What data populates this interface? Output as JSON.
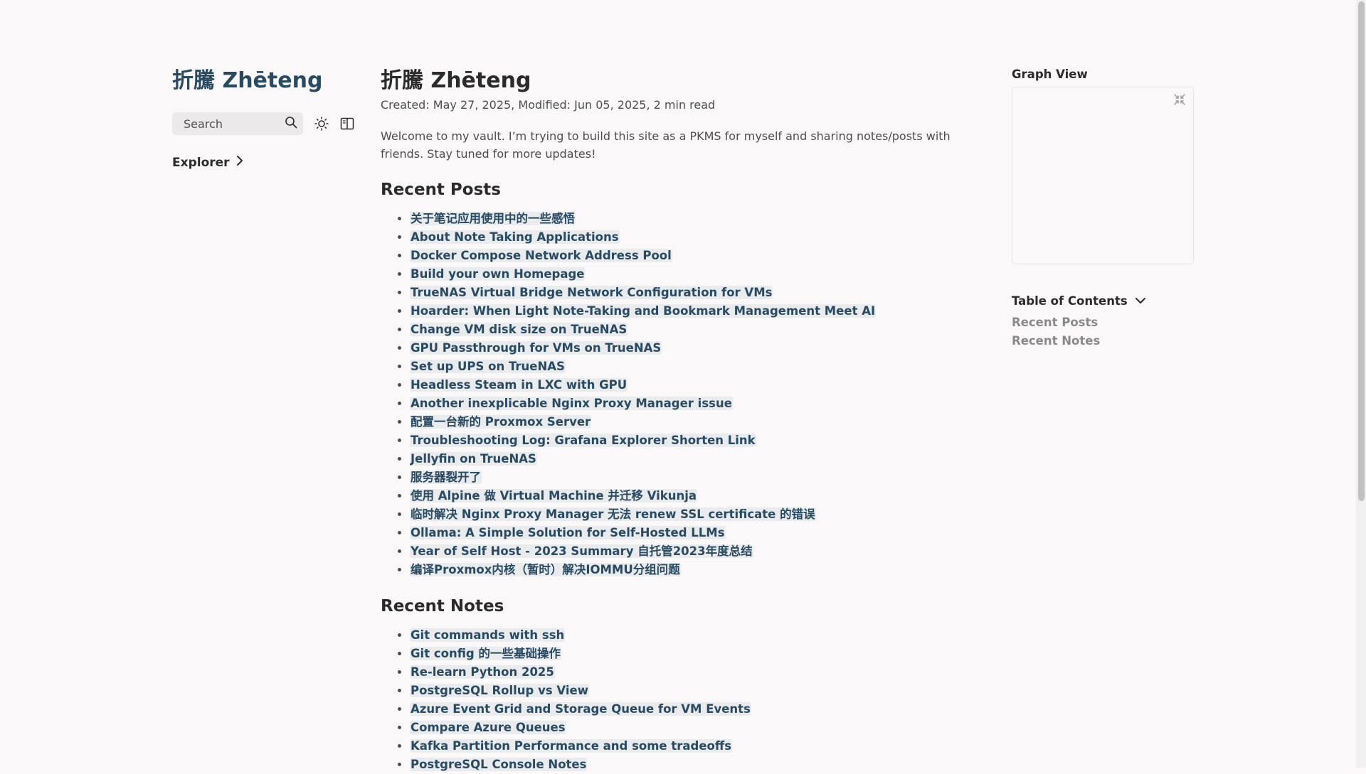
{
  "site": {
    "title": "折騰 Zhēteng"
  },
  "search": {
    "placeholder": "Search"
  },
  "icons": {
    "search": "search-icon",
    "darkmode": "sun-icon",
    "reader": "book-icon",
    "explorer_toggle": "chevron-right-icon",
    "graph_expand": "expand-icon",
    "toc_toggle": "chevron-down-icon"
  },
  "explorer": {
    "label": "Explorer"
  },
  "page": {
    "title": "折騰 Zhēteng",
    "created": "Created: May 27, 2025,",
    "modified": "Modified: Jun 05, 2025,",
    "read_time": "2 min read",
    "intro": "Welcome to my vault. I’m trying to build this site as a PKMS for myself and sharing notes/posts with friends. Stay tuned for more updates!"
  },
  "recent_posts": {
    "heading": "Recent Posts",
    "items": [
      "关于笔记应用使用中的一些感悟",
      "About Note Taking Applications",
      "Docker Compose Network Address Pool",
      "Build your own Homepage",
      "TrueNAS Virtual Bridge Network Configuration for VMs",
      "Hoarder: When Light Note-Taking and Bookmark Management Meet AI",
      "Change VM disk size on TrueNAS",
      "GPU Passthrough for VMs on TrueNAS",
      "Set up UPS on TrueNAS",
      "Headless Steam in LXC with GPU",
      "Another inexplicable Nginx Proxy Manager issue",
      "配置一台新的 Proxmox Server",
      "Troubleshooting Log: Grafana Explorer Shorten Link",
      "Jellyfin on TrueNAS",
      "服务器裂开了",
      "使用 Alpine 做 Virtual Machine 并迁移 Vikunja",
      "临时解决 Nginx Proxy Manager 无法 renew SSL certificate 的错误",
      "Ollama: A Simple Solution for Self-Hosted LLMs",
      "Year of Self Host - 2023 Summary 自托管2023年度总结",
      "编译Proxmox内核（暂时）解决IOMMU分组问题"
    ]
  },
  "recent_notes": {
    "heading": "Recent Notes",
    "items": [
      "Git commands with ssh",
      "Git config 的一些基础操作",
      "Re-learn Python 2025",
      "PostgreSQL Rollup vs View",
      "Azure Event Grid and Storage Queue for VM Events",
      "Compare Azure Queues",
      "Kafka Partition Performance and some tradeoffs",
      "PostgreSQL Console Notes"
    ]
  },
  "graph": {
    "label": "Graph View"
  },
  "toc": {
    "heading": "Table of Contents",
    "items": [
      "Recent Posts",
      "Recent Notes"
    ]
  },
  "colors": {
    "accent": "#284b63",
    "background": "#faf8f8",
    "link_highlight": "rgba(143,159,169,0.15)",
    "muted": "#8a8a8a"
  }
}
